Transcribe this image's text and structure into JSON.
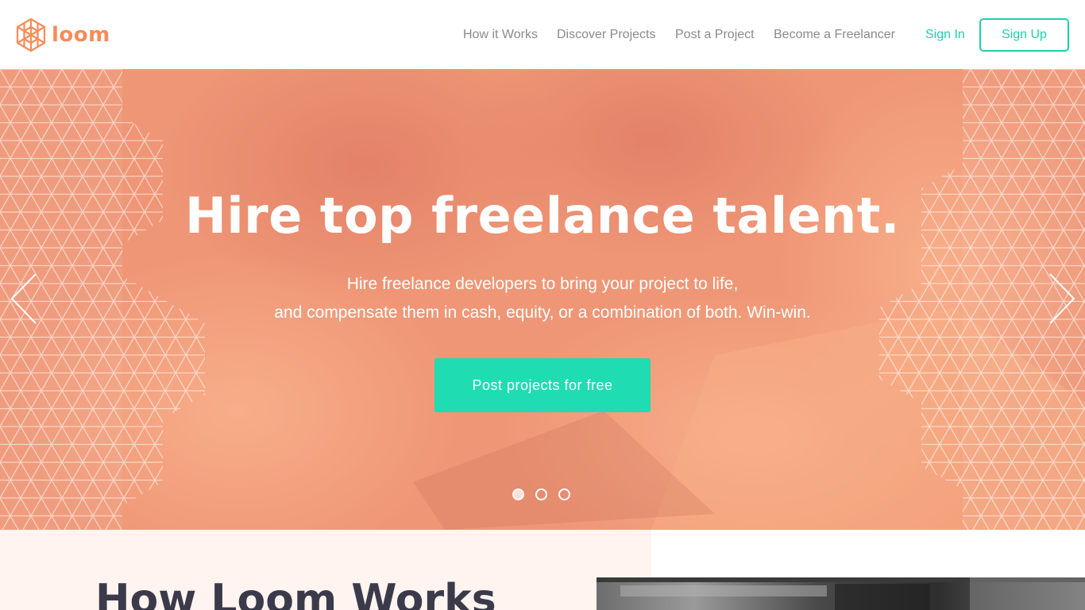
{
  "brand": {
    "name": "loom",
    "accent": "#f58c5a"
  },
  "nav": {
    "items": [
      {
        "label": "How it Works"
      },
      {
        "label": "Discover Projects"
      },
      {
        "label": "Post a Project"
      },
      {
        "label": "Become a Freelancer"
      }
    ],
    "sign_in": "Sign In",
    "sign_up": "Sign Up",
    "cta_color": "#1fcfae"
  },
  "hero": {
    "title": "Hire top freelance talent.",
    "subtitle_line_1": "Hire freelance developers to bring your project to life,",
    "subtitle_line_2": "and compensate them in cash, equity, or a combination of both. Win-win.",
    "cta_label": "Post projects for free",
    "overlay_color": "#f39a78",
    "slides": {
      "count": 3,
      "active": 1
    }
  },
  "how_it_works": {
    "title": "How Loom Works"
  },
  "icons": {
    "logo": "hexagon-lattice-logo-icon",
    "prev": "chevron-left-icon",
    "next": "chevron-right-icon"
  }
}
